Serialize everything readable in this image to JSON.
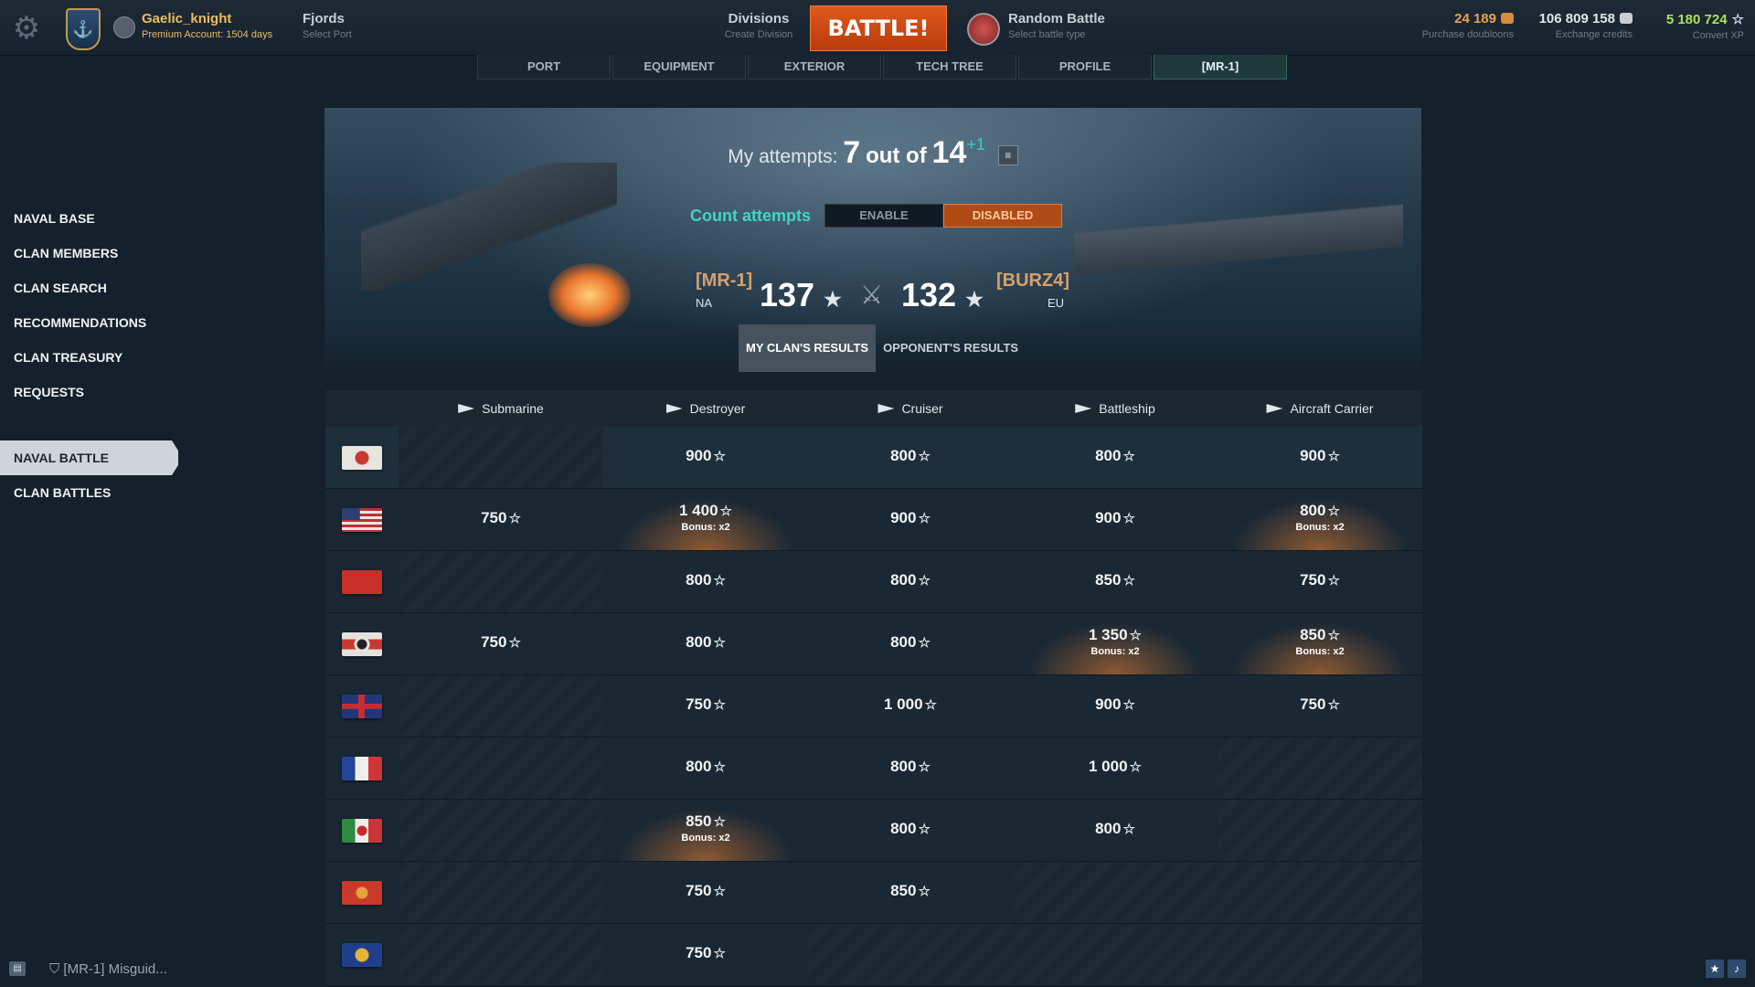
{
  "topbar": {
    "username": "Gaelic_knight",
    "premium": "Premium Account: 1504 days",
    "port_title": "Fjords",
    "port_sub": "Select Port",
    "divisions_title": "Divisions",
    "divisions_sub": "Create Division",
    "battle_label": "BATTLE!",
    "battle_type": "Random Battle",
    "battle_type_sub": "Select battle type",
    "doubloons": "24 189",
    "doubloons_sub": "Purchase doubloons",
    "credits": "106 809 158",
    "credits_sub": "Exchange credits",
    "xp": "5 180 724",
    "xp_sub": "Convert XP"
  },
  "tabs": [
    "PORT",
    "EQUIPMENT",
    "EXTERIOR",
    "TECH TREE",
    "PROFILE",
    "[MR-1]"
  ],
  "sidebar": {
    "group1": [
      "NAVAL BASE",
      "CLAN MEMBERS",
      "CLAN SEARCH",
      "RECOMMENDATIONS",
      "CLAN TREASURY",
      "REQUESTS"
    ],
    "group2": [
      "NAVAL BATTLE",
      "CLAN BATTLES"
    ]
  },
  "banner": {
    "attempts_label": "My attempts:",
    "attempts_used": "7",
    "attempts_of": "out of",
    "attempts_total": "14",
    "attempts_bonus": "+1",
    "count_label": "Count attempts",
    "enable": "ENABLE",
    "disabled": "DISABLED",
    "my_clan": "[MR-1]",
    "my_region": "NA",
    "my_score": "137",
    "opp_clan": "[BURZ4]",
    "opp_region": "EU",
    "opp_score": "132",
    "tab_mine": "MY CLAN'S RESULTS",
    "tab_opp": "OPPONENT'S RESULTS"
  },
  "table": {
    "columns": [
      "Submarine",
      "Destroyer",
      "Cruiser",
      "Battleship",
      "Aircraft Carrier"
    ],
    "rows": [
      {
        "flag": "japan",
        "cells": [
          null,
          {
            "v": "900"
          },
          {
            "v": "800"
          },
          {
            "v": "800"
          },
          {
            "v": "900"
          }
        ]
      },
      {
        "flag": "usa",
        "cells": [
          {
            "v": "750"
          },
          {
            "v": "1 400",
            "bonus": "Bonus: x2"
          },
          {
            "v": "900"
          },
          {
            "v": "900"
          },
          {
            "v": "800",
            "bonus": "Bonus: x2"
          }
        ]
      },
      {
        "flag": "ussr",
        "cells": [
          null,
          {
            "v": "800"
          },
          {
            "v": "800"
          },
          {
            "v": "850"
          },
          {
            "v": "750"
          }
        ]
      },
      {
        "flag": "germany",
        "cells": [
          {
            "v": "750"
          },
          {
            "v": "800"
          },
          {
            "v": "800"
          },
          {
            "v": "1 350",
            "bonus": "Bonus: x2"
          },
          {
            "v": "850",
            "bonus": "Bonus: x2"
          }
        ]
      },
      {
        "flag": "uk",
        "cells": [
          null,
          {
            "v": "750"
          },
          {
            "v": "1 000"
          },
          {
            "v": "900"
          },
          {
            "v": "750"
          }
        ]
      },
      {
        "flag": "france",
        "cells": [
          null,
          {
            "v": "800"
          },
          {
            "v": "800"
          },
          {
            "v": "1 000"
          },
          null
        ]
      },
      {
        "flag": "italy",
        "cells": [
          null,
          {
            "v": "850",
            "bonus": "Bonus: x2"
          },
          {
            "v": "800"
          },
          {
            "v": "800"
          },
          null
        ]
      },
      {
        "flag": "panasia",
        "cells": [
          null,
          {
            "v": "750"
          },
          {
            "v": "850"
          },
          null,
          null
        ]
      },
      {
        "flag": "europe",
        "cells": [
          null,
          {
            "v": "750"
          },
          null,
          null,
          null
        ]
      }
    ]
  },
  "chat": {
    "text": "[MR-1] Misguid..."
  }
}
